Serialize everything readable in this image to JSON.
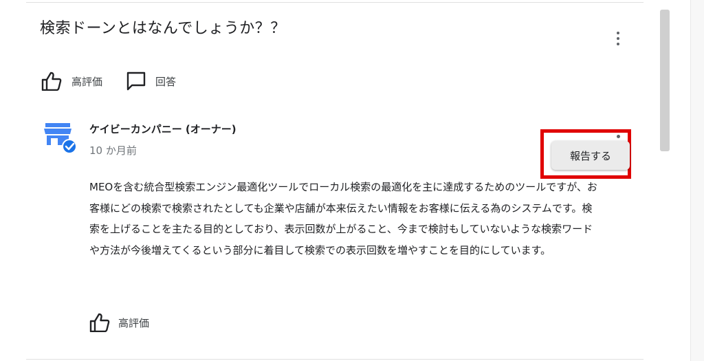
{
  "question": {
    "title": "検索ドーンとはなんでしょうか？？",
    "like_label": "高評価",
    "answer_label": "回答"
  },
  "answer": {
    "owner_name": "ケイビーカンパニー (オーナー)",
    "timestamp": "10 か月前",
    "text": "MEOを含む統合型検索エンジン最適化ツールでローカル検索の最適化を主に達成するためのツールですが、お客様にどの検索で検索されたとしても企業や店舗が本来伝えたい情報をお客様に伝える為のシステムです。検索を上げることを主たる目的としており、表示回数が上がること、今まで検討もしていないような検索ワードや方法が今後増えてくるという部分に着目して検索での表示回数を増やすことを目的にしています。",
    "like_label": "高評価",
    "report_label": "報告する"
  },
  "icons": {
    "like": "thumb-up-icon",
    "answer": "comment-icon",
    "more": "more-vert-icon",
    "avatar": "store-verified-icon"
  },
  "colors": {
    "highlight": "#e00000",
    "avatar_blue": "#4285f4",
    "verified_blue": "#1a73e8"
  }
}
